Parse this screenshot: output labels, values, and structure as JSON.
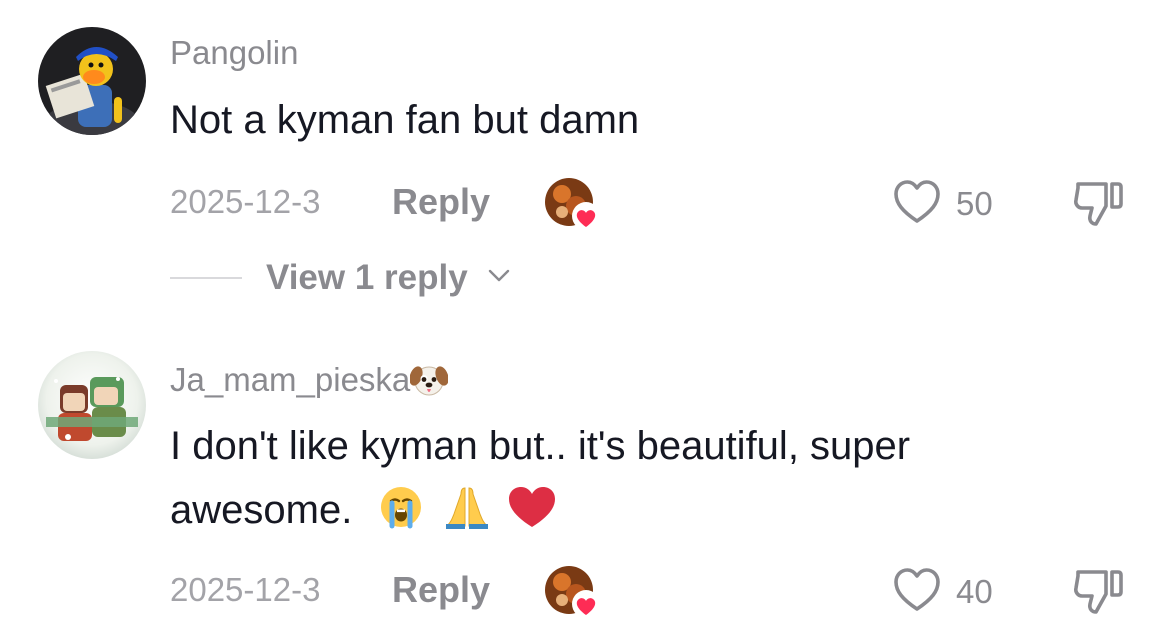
{
  "comments": [
    {
      "username": "Pangolin",
      "text": "Not a kyman fan but damn",
      "date": "2025-12-3",
      "reply_label": "Reply",
      "likes": "50",
      "view_replies_label": "View 1 reply"
    },
    {
      "username": "Ja_mam_pieska",
      "username_emoji": "dog-face-emoji",
      "text_line1": "I don't like kyman but.. it's beautiful, super",
      "text_line2": "awesome.",
      "text_emojis": [
        "loudly-crying-face-emoji",
        "folded-hands-emoji",
        "red-heart-emoji"
      ],
      "date": "2025-12-3",
      "reply_label": "Reply",
      "likes": "40"
    }
  ],
  "colors": {
    "primary_text": "#161823",
    "secondary_text": "#8a8a8f",
    "date_text": "#a3a3a8",
    "liked_heart_badge": "#fe2c55"
  },
  "icons": {
    "like": "heart-outline-icon",
    "dislike": "thumbs-down-outline-icon",
    "creator_liked": "creator-liked-badge",
    "expand": "chevron-down-icon"
  }
}
